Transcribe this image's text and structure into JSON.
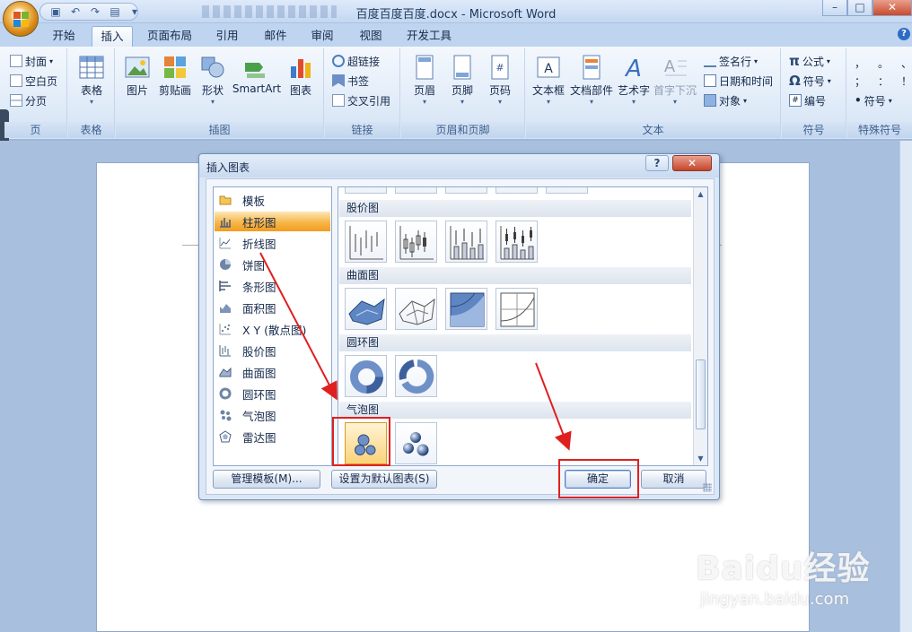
{
  "window": {
    "title": "百度百度百度.docx - Microsoft Word",
    "controls": [
      "–",
      "□",
      "✕"
    ]
  },
  "tabs": [
    {
      "label": "开始"
    },
    {
      "label": "插入",
      "active": true
    },
    {
      "label": "页面布局"
    },
    {
      "label": "引用"
    },
    {
      "label": "邮件"
    },
    {
      "label": "审阅"
    },
    {
      "label": "视图"
    },
    {
      "label": "开发工具"
    }
  ],
  "ribbon": {
    "pages": {
      "label": "页",
      "items": [
        "封面",
        "空白页",
        "分页"
      ]
    },
    "tables": {
      "label": "表格",
      "button": "表格"
    },
    "illustrations": {
      "label": "插图",
      "buttons": [
        "图片",
        "剪贴画",
        "形状",
        "SmartArt",
        "图表"
      ]
    },
    "links": {
      "label": "链接",
      "items": [
        "超链接",
        "书签",
        "交叉引用"
      ]
    },
    "header_footer": {
      "label": "页眉和页脚",
      "buttons": [
        "页眉",
        "页脚",
        "页码"
      ]
    },
    "text": {
      "label": "文本",
      "buttons": [
        "文本框",
        "文档部件",
        "艺术字",
        "首字下沉"
      ],
      "items": [
        "签名行",
        "日期和时间",
        "对象"
      ]
    },
    "symbols": {
      "label": "符号",
      "items": [
        "公式",
        "符号",
        "编号"
      ]
    },
    "special": {
      "label": "特殊符号",
      "chars": [
        "，",
        "。",
        "、",
        "；",
        "：",
        "！"
      ],
      "item": "符号"
    }
  },
  "dialog": {
    "title": "插入图表",
    "help": "?",
    "close": "✕",
    "categories": [
      {
        "label": "模板",
        "icon": "folder-icon"
      },
      {
        "label": "柱形图",
        "icon": "column-chart-icon",
        "selected": true
      },
      {
        "label": "折线图",
        "icon": "line-chart-icon"
      },
      {
        "label": "饼图",
        "icon": "pie-chart-icon"
      },
      {
        "label": "条形图",
        "icon": "bar-chart-icon"
      },
      {
        "label": "面积图",
        "icon": "area-chart-icon"
      },
      {
        "label": "X Y (散点图)",
        "icon": "scatter-chart-icon"
      },
      {
        "label": "股价图",
        "icon": "stock-chart-icon"
      },
      {
        "label": "曲面图",
        "icon": "surface-chart-icon"
      },
      {
        "label": "圆环图",
        "icon": "doughnut-chart-icon"
      },
      {
        "label": "气泡图",
        "icon": "bubble-chart-icon"
      },
      {
        "label": "雷达图",
        "icon": "radar-chart-icon"
      }
    ],
    "sections": [
      {
        "label": "股价图",
        "thumbs": 4
      },
      {
        "label": "曲面图",
        "thumbs": 4
      },
      {
        "label": "圆环图",
        "thumbs": 2
      },
      {
        "label": "气泡图",
        "thumbs": 2,
        "selected_index": 0
      }
    ],
    "buttons": {
      "manage": "管理模板(M)...",
      "set_default": "设置为默认图表(S)",
      "ok": "确定",
      "cancel": "取消"
    }
  },
  "watermark": {
    "brand": "Baidu经验",
    "url": "jingyan.baidu.com"
  }
}
